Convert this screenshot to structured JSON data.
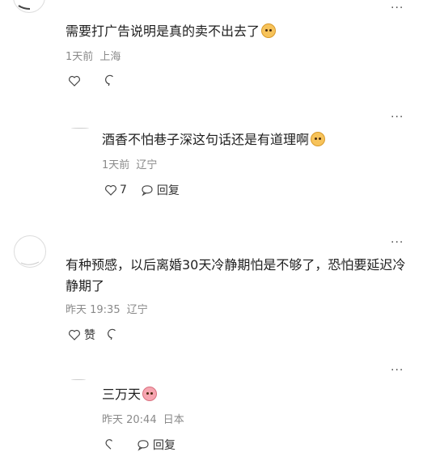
{
  "more_glyph": "···",
  "comments": [
    {
      "text": "需要打广告说明是真的卖不出去了",
      "emoji": "face-emoji",
      "time": "1天前",
      "location": "上海",
      "likes": "",
      "like_label": "",
      "reply_label": ""
    },
    {
      "text": "酒香不怕巷子深这句话还是有道理啊",
      "emoji": "face-emoji",
      "time": "1天前",
      "location": "辽宁",
      "likes": "7",
      "reply_label": "回复"
    },
    {
      "text": "有种预感，以后离婚30天冷静期怕是不够了，恐怕要延迟冷静期了",
      "time": "昨天 19:35",
      "location": "辽宁",
      "like_label": "赞",
      "reply_label": ""
    },
    {
      "text": "三万天",
      "emoji": "crying-face-emoji",
      "time": "昨天 20:44",
      "location": "日本",
      "reply_label": "回复"
    }
  ]
}
